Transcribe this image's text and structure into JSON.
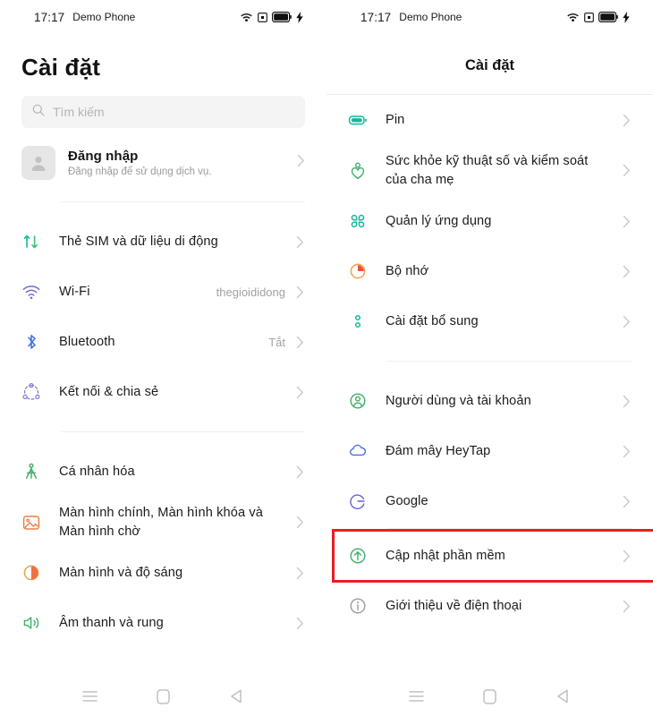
{
  "colors": {
    "highlight": "#ee1c22",
    "teal": "#16b89a",
    "green": "#2fa84f",
    "blue": "#4a6ee0",
    "purple": "#6d6fd4",
    "orange": "#f08a3c",
    "red_orange": "#e8543f",
    "gray": "#9b9b9b"
  },
  "status_bar": {
    "time": "17:17",
    "carrier": "Demo Phone",
    "icons": [
      "wifi-icon",
      "cast-icon",
      "battery-icon",
      "charging-bolt-icon"
    ]
  },
  "left_phone": {
    "title": "Cài đặt",
    "search": {
      "placeholder": "Tìm kiếm",
      "value": "",
      "icon": "search-icon"
    },
    "account": {
      "title": "Đăng nhập",
      "subtitle": "Đăng nhập để sử dụng dịch vụ.",
      "avatar_icon": "person-avatar-icon"
    },
    "groups": [
      {
        "items": [
          {
            "label": "Thẻ SIM và dữ liệu di động",
            "value": "",
            "icon": "sim-data-icon"
          },
          {
            "label": "Wi-Fi",
            "value": "thegioididong",
            "icon": "wifi-icon"
          },
          {
            "label": "Bluetooth",
            "value": "Tắt",
            "icon": "bluetooth-icon"
          },
          {
            "label": "Kết nối & chia sẻ",
            "value": "",
            "icon": "share-connect-icon"
          }
        ]
      },
      {
        "items": [
          {
            "label": "Cá nhân hóa",
            "value": "",
            "icon": "personalize-compass-icon"
          },
          {
            "label": "Màn hình chính, Màn hình khóa và Màn hình chờ",
            "value": "",
            "icon": "wallpaper-icon"
          },
          {
            "label": "Màn hình và độ sáng",
            "value": "",
            "icon": "brightness-icon"
          },
          {
            "label": "Âm thanh và rung",
            "value": "",
            "icon": "sound-vibration-icon"
          }
        ]
      }
    ]
  },
  "right_phone": {
    "title": "Cài đặt",
    "groups": [
      {
        "items": [
          {
            "label": "Pin",
            "value": "",
            "icon": "battery-icon",
            "highlighted": false
          },
          {
            "label": "Sức khỏe kỹ thuật số và kiểm soát của cha mẹ",
            "value": "",
            "icon": "digital-wellbeing-icon",
            "highlighted": false
          },
          {
            "label": "Quản lý ứng dụng",
            "value": "",
            "icon": "app-management-icon",
            "highlighted": false
          },
          {
            "label": "Bộ nhớ",
            "value": "",
            "icon": "storage-pie-icon",
            "highlighted": false
          },
          {
            "label": "Cài đặt bổ sung",
            "value": "",
            "icon": "additional-settings-icon",
            "highlighted": false
          }
        ]
      },
      {
        "items": [
          {
            "label": "Người dùng và tài khoản",
            "value": "",
            "icon": "users-accounts-icon",
            "highlighted": false
          },
          {
            "label": "Đám mây HeyTap",
            "value": "",
            "icon": "cloud-icon",
            "highlighted": false
          },
          {
            "label": "Google",
            "value": "",
            "icon": "google-icon",
            "highlighted": false
          },
          {
            "label": "Cập nhật phần mềm",
            "value": "",
            "icon": "software-update-icon",
            "highlighted": true
          },
          {
            "label": "Giới thiệu về điện thoại",
            "value": "",
            "icon": "info-icon",
            "highlighted": false
          }
        ]
      }
    ]
  },
  "nav_bar": {
    "buttons": [
      {
        "name": "recents-button",
        "icon": "menu-lines-icon"
      },
      {
        "name": "home-button",
        "icon": "square-icon"
      },
      {
        "name": "back-button",
        "icon": "triangle-left-icon"
      }
    ]
  }
}
